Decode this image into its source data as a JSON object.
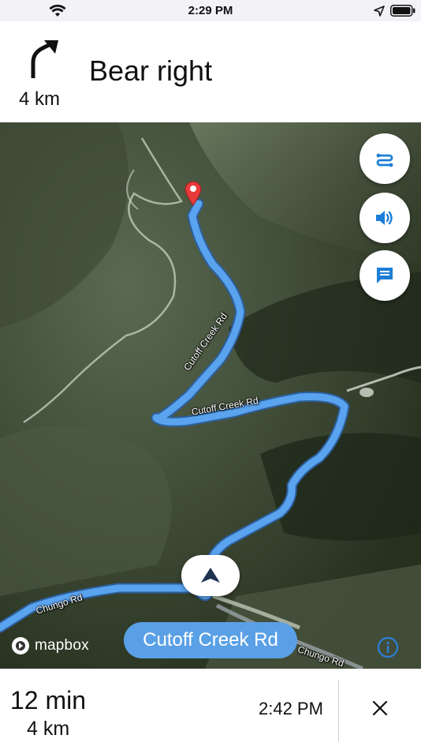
{
  "status_bar": {
    "time": "2:29 PM",
    "icons": [
      "wifi-icon",
      "location-arrow-icon",
      "battery-icon"
    ]
  },
  "maneuver": {
    "icon": "bear-right-arrow-icon",
    "distance": "4 km",
    "instruction": "Bear right"
  },
  "map": {
    "road_labels": [
      "Cutoff Creek Rd",
      "Cutoff Creek Rd",
      "Chungo Rd",
      "Chungo Rd"
    ],
    "buttons": [
      "route-overview-icon",
      "sound-icon",
      "feedback-icon"
    ],
    "current_street": "Cutoff Creek Rd",
    "attribution": "mapbox",
    "route_color": "#4f93e8",
    "pin_color": "#e83a3a"
  },
  "bottom": {
    "duration": "12 min",
    "distance": "4 km",
    "arrival_time": "2:42 PM",
    "close_icon": "close-icon"
  }
}
